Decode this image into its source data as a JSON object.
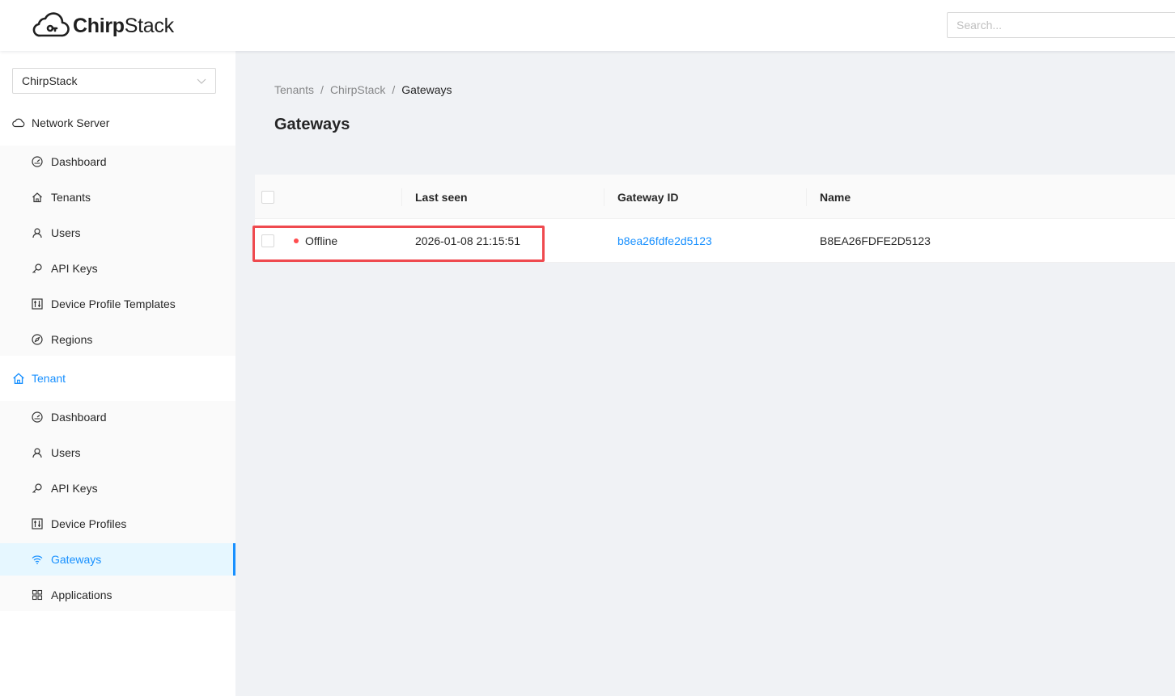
{
  "header": {
    "logo_text_bold": "Chirp",
    "logo_text_regular": "Stack",
    "search_placeholder": "Search..."
  },
  "sidebar": {
    "tenant_selector": {
      "value": "ChirpStack",
      "icon": "chevron-down-icon"
    },
    "network_server": {
      "label": "Network Server",
      "icon": "cloud-icon",
      "items": [
        {
          "label": "Dashboard",
          "icon": "dashboard-icon"
        },
        {
          "label": "Tenants",
          "icon": "home-icon"
        },
        {
          "label": "Users",
          "icon": "user-icon"
        },
        {
          "label": "API Keys",
          "icon": "key-icon"
        },
        {
          "label": "Device Profile Templates",
          "icon": "control-icon"
        },
        {
          "label": "Regions",
          "icon": "compass-icon"
        }
      ]
    },
    "tenant": {
      "label": "Tenant",
      "icon": "home-icon",
      "items": [
        {
          "label": "Dashboard",
          "icon": "dashboard-icon"
        },
        {
          "label": "Users",
          "icon": "user-icon"
        },
        {
          "label": "API Keys",
          "icon": "key-icon"
        },
        {
          "label": "Device Profiles",
          "icon": "control-icon"
        },
        {
          "label": "Gateways",
          "icon": "wifi-icon",
          "selected": true
        },
        {
          "label": "Applications",
          "icon": "appstore-icon"
        }
      ]
    }
  },
  "content": {
    "breadcrumb": [
      "Tenants",
      "ChirpStack",
      "Gateways"
    ],
    "breadcrumb_separator": "/",
    "title": "Gateways",
    "table": {
      "columns": [
        "",
        "Last seen",
        "Gateway ID",
        "Name"
      ],
      "rows": [
        {
          "status": "Offline",
          "last_seen": "2026-01-08 21:15:51",
          "gateway_id": "b8ea26fdfe2d5123",
          "name": "B8EA26FDFE2D5123"
        }
      ]
    }
  },
  "colors": {
    "accent": "#1890ff",
    "status_offline": "#ff4d4f",
    "highlight_box": "#ef4a4f"
  }
}
